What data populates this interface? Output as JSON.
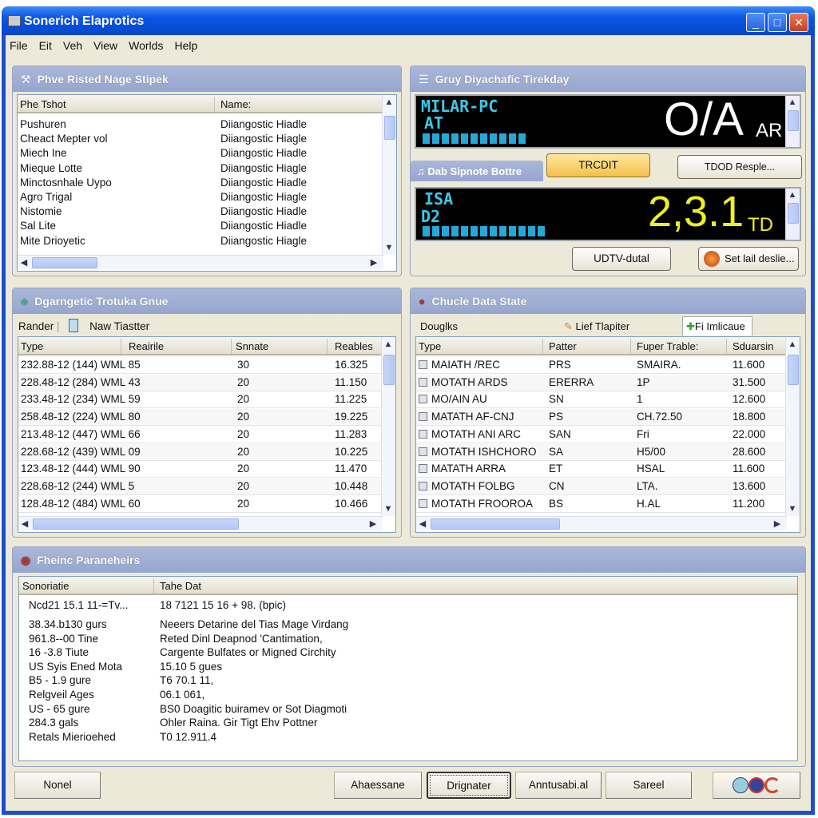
{
  "window": {
    "title": "Sonerich Elaprotics",
    "controls": [
      "_",
      "□",
      "✕"
    ]
  },
  "menu": [
    "File",
    "Eit",
    "Veh",
    "View",
    "Worlds",
    "Help"
  ],
  "panel_list": {
    "title": "Phve Risted Nage Stipek",
    "columns": [
      "Phe Tshot",
      "Name:"
    ],
    "rows": [
      [
        "Pushuren",
        "Diiangostic Hiadle"
      ],
      [
        "Cheact Mepter vol",
        "Diiangostic Hiagle"
      ],
      [
        "Miech Ine",
        "Diiangostic Hiadle"
      ],
      [
        "Mieque Lotte",
        "Diiangostic Hiagle"
      ],
      [
        "Minctosnhale Uypo",
        "Diiangostic Hiadle"
      ],
      [
        "Agro Trigal",
        "Diiangostic Hiagle"
      ],
      [
        "Nistomie",
        "Diiangostic Hiadle"
      ],
      [
        "Sal Lite",
        "Diiangostic Hiadle"
      ],
      [
        "Mite Drioyetic",
        "Diiangostic Hiagle"
      ]
    ]
  },
  "panel_display": {
    "title": "Gruy Diyachafic Tirekday",
    "display1": {
      "line1": "MILAR-PC",
      "line2": "AT",
      "value": "O/A",
      "unit": "AR",
      "level_segments": 11
    },
    "tab": "Dab Sipnote Bottre",
    "button_primary": "TRCDIT",
    "button_secondary": "TDOD Resple...",
    "display2": {
      "line1": "ISA",
      "line2": "D2",
      "value": "2,3.1",
      "unit": "TD",
      "level_segments": 13
    },
    "button_udtv": "UDTV-dutal",
    "button_set": "Set lail deslie..."
  },
  "panel_trouble": {
    "title": "Dgarngetic Trotuka Gnue",
    "toolbar": {
      "render": "Rander",
      "new": "Naw Tiastter"
    },
    "columns": [
      "Type",
      "Reairile",
      "Snnate",
      "Reables"
    ],
    "rows": [
      [
        "232.88-12 (144) WML 85",
        "30",
        "16.325"
      ],
      [
        "228.48-12 (284) WML 43",
        "20",
        "11.150"
      ],
      [
        "233.48-12 (234) WML 59",
        "20",
        "11.225"
      ],
      [
        "258.48-12 (224) WML 80",
        "20",
        "19.225"
      ],
      [
        "213.48-12 (447) WML 66",
        "20",
        "11.283"
      ],
      [
        "228.68-12 (439) WML 09",
        "20",
        "10.225"
      ],
      [
        "123.48-12 (444) WML 90",
        "20",
        "11.470"
      ],
      [
        "228.68-12 (244) WML 5",
        "20",
        "10.448"
      ],
      [
        "128.48-12 (484) WML 60",
        "20",
        "10.466"
      ]
    ]
  },
  "panel_state": {
    "title": "Chucle Data State",
    "tabs": [
      "Douglks",
      "Lief Tlapiter",
      "Fi Imlicaue"
    ],
    "columns": [
      "Type",
      "Patter",
      "Fuper Trable:",
      "Sduarsin"
    ],
    "rows": [
      [
        "MAIATH /REC",
        "PRS",
        "SMAIRA.",
        "11.600"
      ],
      [
        "MOTATH ARDS",
        "ERERRA",
        "1P",
        "31.500"
      ],
      [
        "MO/AIN AU",
        "SN",
        "1",
        "12.600"
      ],
      [
        "MATATH AF-CNJ",
        "PS",
        "CH.72.50",
        "18.800"
      ],
      [
        "MOTATH ANI ARC",
        "SAN",
        "Fri",
        "22.000"
      ],
      [
        "MOTATH ISHCHORO",
        "SA",
        "H5/00",
        "28.600"
      ],
      [
        "MATATH ARRA",
        "ET",
        "HSAL",
        "11.600"
      ],
      [
        "MOTATH FOLBG",
        "CN",
        "LTA.",
        "13.600"
      ],
      [
        "MOTATH FROOROA",
        "BS",
        "H.AL",
        "11.200"
      ]
    ]
  },
  "panel_params": {
    "title": "Fheinc Paraneheirs",
    "columns": [
      "Sonoriatie",
      "Tahe Dat"
    ],
    "rows": [
      [
        "Ncd21 15.1 11-=Tv...",
        "18 7121 15 16 + 98. (bpic)"
      ],
      [
        "38.34.b130 gurs",
        "Neeers Detarine del Tias Mage Virdang"
      ],
      [
        "961.8--00 Tine",
        "Reted Dinl Deapnod 'Cantimation,"
      ],
      [
        "16 -3.8 Tiute",
        "Cargente Bulfates or Migned Circhity"
      ],
      [
        "US Syis Ened Mota",
        "15.10 5 gues"
      ],
      [
        "B5 - 1.9 gure",
        "T6 70.1 11,"
      ],
      [
        "Relgveil Ages",
        "06.1 061,"
      ],
      [
        "US - 65 gure",
        "BS0 Doagitic buiramev or Sot Diagmoti"
      ],
      [
        "284.3 gals",
        "Ohler Raina. Gir Tigt Ehv Pottner"
      ],
      [
        "Retals Mierioehed",
        "T0 12.911.4"
      ]
    ]
  },
  "buttons": {
    "none": "Nonel",
    "ahaessane": "Ahaessane",
    "drignater": "Drignater",
    "anntusabi": "Anntusabi.al",
    "sareel": "Sareel"
  },
  "colors": {
    "title_bar": "#0a55e3",
    "panel_header": "#9fafd4",
    "lcd_cyan": "#3cc8e8",
    "lcd_yellow": "#f0f020",
    "highlight_button": "#f8c850"
  }
}
